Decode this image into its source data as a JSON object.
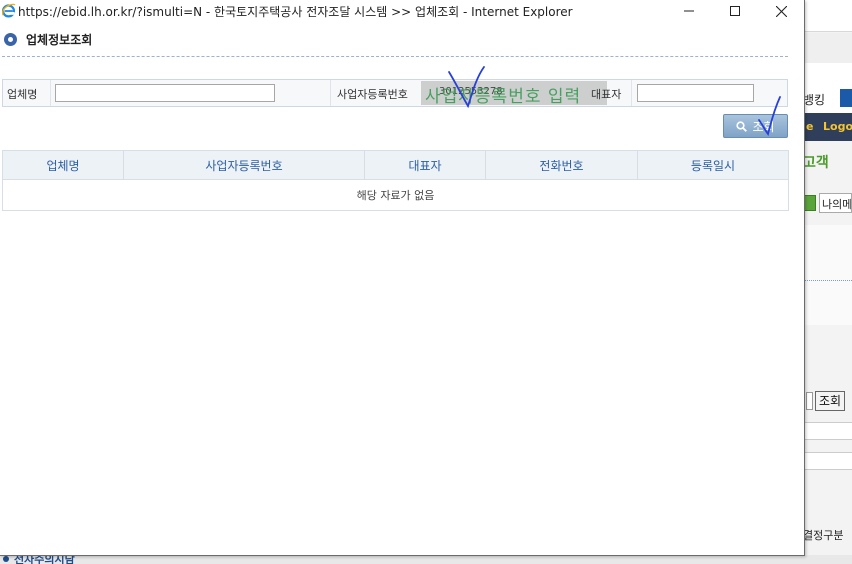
{
  "window": {
    "title": "https://ebid.lh.or.kr/?ismulti=N - 한국토지주택공사 전자조달 시스템 >> 업체조회 - Internet Explorer",
    "minimize_glyph": "—",
    "maximize_glyph": "☐",
    "close_glyph": "✕"
  },
  "page": {
    "section_title": "업체정보조회"
  },
  "search": {
    "company_name_label": "업체명",
    "company_name_value": "",
    "reg_no_label": "사업자등록번호",
    "reg_no_value": "3012553278",
    "representative_label": "대표자",
    "representative_value": "",
    "search_button_label": "조회",
    "annotation_text": "사업자등록번호 입력"
  },
  "table": {
    "columns": [
      "업체명",
      "사업자등록번호",
      "대표자",
      "전화번호",
      "등록일시"
    ],
    "empty_message": "해당 자료가 없음"
  },
  "background": {
    "banking_text": "뱅킹",
    "menu_e": "e",
    "menu_logout": "Logou",
    "service_text": "고객",
    "mypage_text": "나의메",
    "search_btn": "조회",
    "decision_text": "결정구분",
    "bottom_text": "전자수의시담"
  },
  "colors": {
    "accent_blue": "#3a64a8",
    "header_text": "#2c5fa3",
    "button_blue": "#7fa3c6",
    "annotation_green": "#3a9c55",
    "annotation_check": "#2840d8"
  }
}
